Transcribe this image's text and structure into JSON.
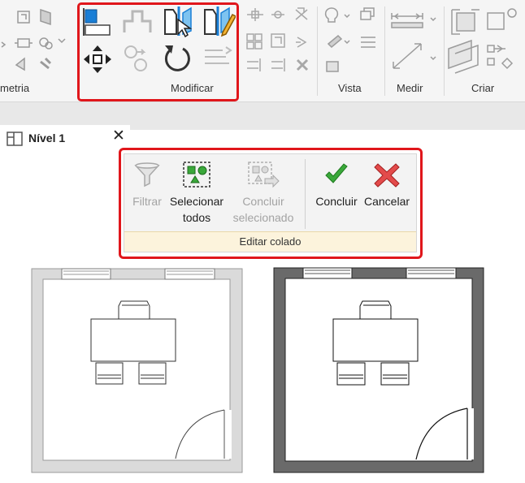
{
  "ribbon": {
    "panels": {
      "geometry": "metria",
      "modify": "Modificar",
      "view": "Vista",
      "measure": "Medir",
      "create": "Criar"
    }
  },
  "view_tab": {
    "title": "Nível 1",
    "close_glyph": "✕"
  },
  "edit_pasted": {
    "panel_title": "Editar colado",
    "buttons": {
      "filter": "Filtrar",
      "select_all_1": "Selecionar",
      "select_all_2": "todos",
      "finish_selected_1": "Concluir",
      "finish_selected_2": "selecionado",
      "finish": "Concluir",
      "cancel": "Cancelar"
    }
  },
  "colors": {
    "highlight": "#e0161b",
    "accent_blue": "#1a7fd6",
    "check_green": "#3aa83a",
    "cancel_red": "#e34b4b",
    "wall_grey": "#d9d9d9",
    "wall_dark": "#6a6a6a"
  },
  "icons": [
    "align-icon",
    "split-icon",
    "offset-icon",
    "mirror-axis-icon",
    "mirror-draw-icon",
    "move-icon",
    "copy-icon",
    "rotate-icon",
    "filter-icon",
    "select-all-icon",
    "finish-selection-icon",
    "check-icon",
    "cancel-x-icon",
    "floor-plan-icon"
  ]
}
